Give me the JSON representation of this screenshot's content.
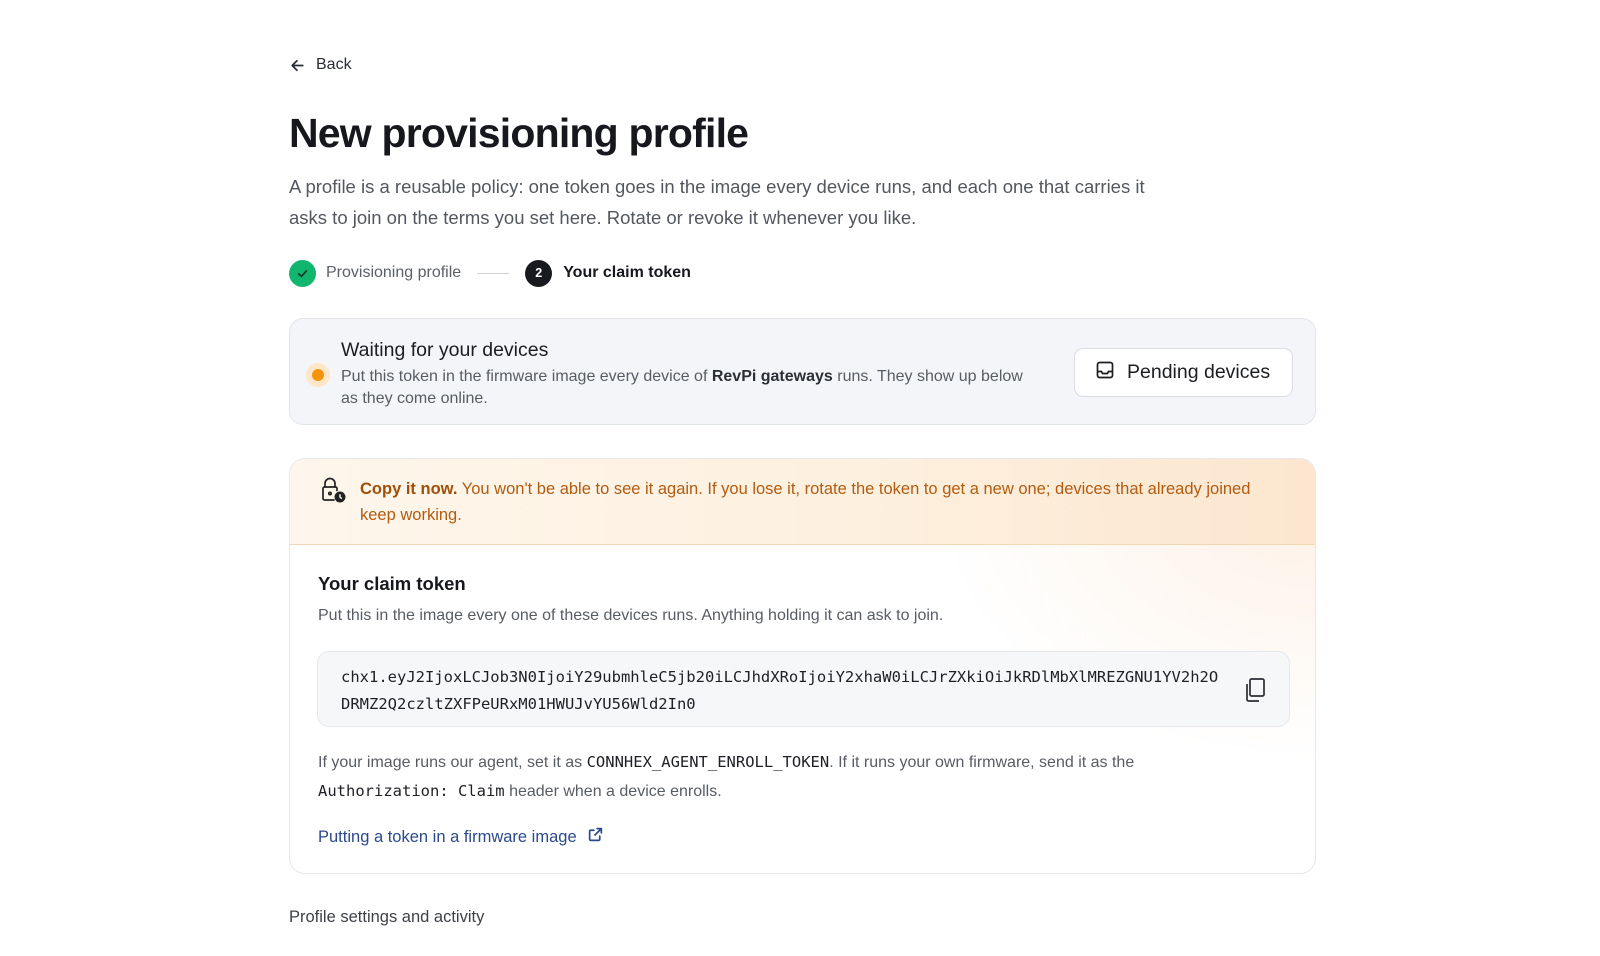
{
  "nav": {
    "back_label": "Back"
  },
  "header": {
    "title": "New provisioning profile",
    "intro": "A profile is a reusable policy: one token goes in the image every device runs, and each one that carries it asks to join on the terms you set here. Rotate or revoke it whenever you like."
  },
  "stepper": {
    "steps": [
      {
        "label": "Provisioning profile",
        "state": "done"
      },
      {
        "label": "Your claim token",
        "number": "2",
        "state": "current"
      }
    ]
  },
  "waiting": {
    "title": "Waiting for your devices",
    "text_before": "Put this token in the firmware image every device of ",
    "device_group": "RevPi gateways",
    "text_after": " runs. They show up below as they come online.",
    "pending_button": "Pending devices",
    "status_color": "#f6930e"
  },
  "warning": {
    "strong": "Copy it now.",
    "text": " You won't be able to see it again. If you lose it, rotate the token to get a new one; devices that already joined keep working."
  },
  "claim_token": {
    "title": "Your claim token",
    "subtitle": "Put this in the image every one of these devices runs. Anything holding it can ask to join.",
    "token": "chx1.eyJ2IjoxLCJob3N0IjoiY29ubmhleC5jb20iLCJhdXRoIjoiY2xhaW0iLCJrZXkiOiJkRDlMbXlMREZGNU1YV2h2ODRMZ2Q2czltZXFPeURxM01HWUJvYU56Wld2In0",
    "copy_icon": "copy-icon",
    "note_1": "If your image runs our agent, set it as ",
    "env_var": "CONNHEX_AGENT_ENROLL_TOKEN",
    "note_2": ". If it runs your own firmware, send it as the ",
    "header_name": "Authorization: Claim",
    "note_3": " header when a device enrolls.",
    "docs_link": "Putting a token in a firmware image"
  },
  "footer": {
    "section_label": "Profile settings and activity"
  },
  "colors": {
    "success": "#10b56e",
    "warning_text": "#b15c10",
    "link": "#2a4a8c"
  }
}
